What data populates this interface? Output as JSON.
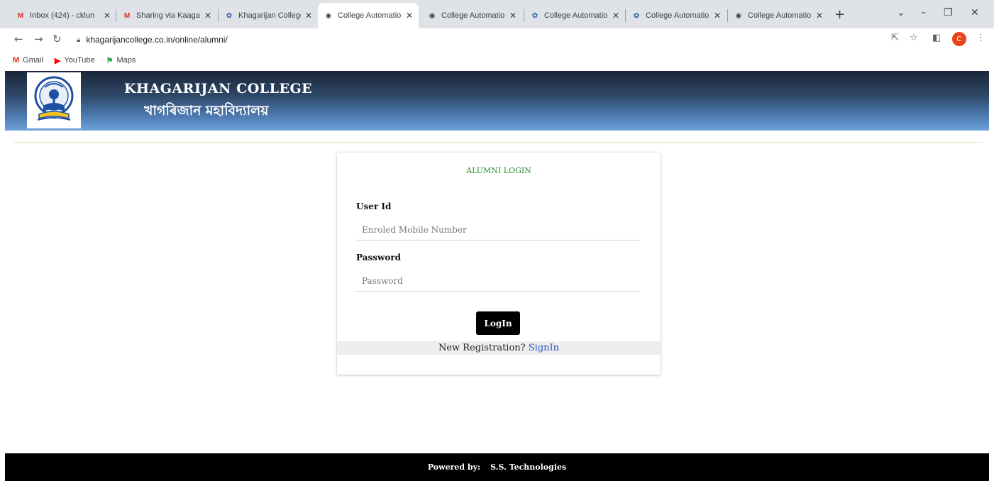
{
  "browser": {
    "tabs": [
      {
        "title": "Inbox (424) - cklun",
        "favicon": "gmail-icon",
        "active": false
      },
      {
        "title": "Sharing via Kaagaz",
        "favicon": "gmail-icon",
        "active": false
      },
      {
        "title": "Khagarijan College",
        "favicon": "college-logo-icon",
        "active": false
      },
      {
        "title": "College Automatio",
        "favicon": "globe-icon",
        "active": true
      },
      {
        "title": "College Automatio",
        "favicon": "globe-icon",
        "active": false
      },
      {
        "title": "College Automatio",
        "favicon": "college-logo-icon",
        "active": false
      },
      {
        "title": "College Automatio",
        "favicon": "college-logo-icon",
        "active": false
      },
      {
        "title": "College Automatio",
        "favicon": "globe-icon",
        "active": false
      }
    ],
    "url": "khagarijancollege.co.in/online/alumni/",
    "profile_initial": "C",
    "bookmarks": [
      {
        "label": "Gmail",
        "icon": "gmail-icon"
      },
      {
        "label": "YouTube",
        "icon": "youtube-icon"
      },
      {
        "label": "Maps",
        "icon": "maps-icon"
      }
    ]
  },
  "header": {
    "college_name_en": "KHAGARIJAN COLLEGE",
    "college_name_bn": "খাগৰিজান মহাবিদ্যালয়"
  },
  "login": {
    "title": "ALUMNI LOGIN",
    "user_id_label": "User Id",
    "user_id_placeholder": "Enroled Mobile Number",
    "password_label": "Password",
    "password_placeholder": "Password",
    "login_button": "LogIn",
    "registration_text": "New Registration?",
    "registration_link": "SignIn"
  },
  "footer": {
    "powered_by": "Powered by:",
    "company": "S.S. Technologies"
  },
  "colors": {
    "accent_green": "#2e8b2e",
    "link_blue": "#2b4fc9",
    "header_dark": "#1b2739",
    "header_light": "#6fa3dc"
  }
}
